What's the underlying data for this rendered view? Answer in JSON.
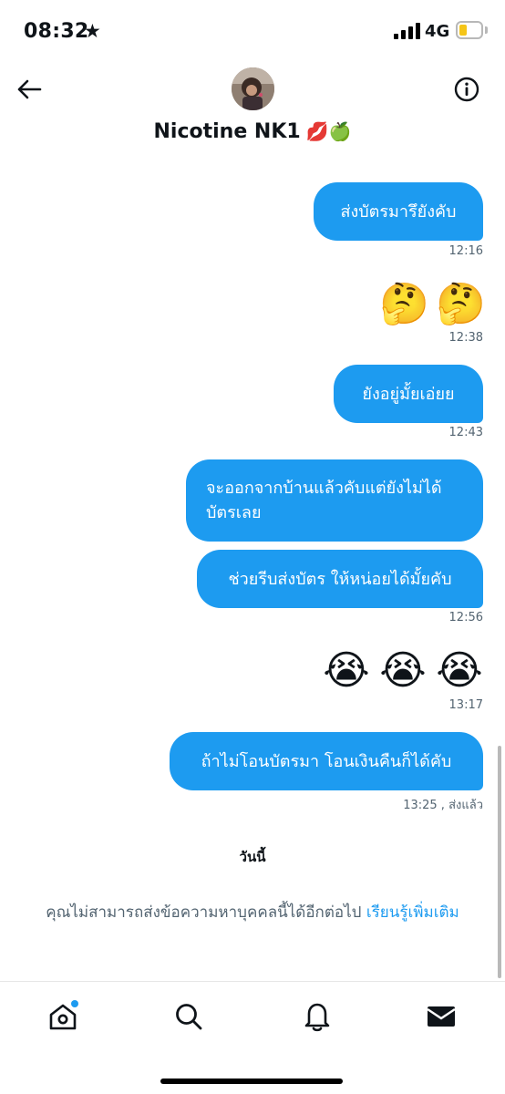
{
  "status_bar": {
    "time": "08:32",
    "network": "4G",
    "battery_level": 0.35,
    "accent_colors": {
      "battery": "#f5c518"
    }
  },
  "header": {
    "contact_name": "Nicotine NK1",
    "name_emojis": "💋🍏",
    "back_icon": "arrow-left-icon",
    "info_icon": "info-circle-icon"
  },
  "messages": [
    {
      "text": "ส่งบัตรมารึยังคับ",
      "time": "12:16"
    },
    {
      "text": "🤔🤔",
      "emojis": [
        "🤔",
        "🤔"
      ],
      "time": "12:38"
    },
    {
      "text": "ยังอยู่มั้ยเอ่ยย",
      "time": "12:43"
    },
    {
      "text": "จะออกจากบ้านแล้วคับแต่ยังไม่ได้บัตรเลย",
      "lines": [
        "จะออกจากบ้านแล้วคับแต่ยังไม่ได้",
        "บัตรเลย"
      ]
    },
    {
      "text": "ช่วยรีบส่งบัตร ให้หน่อยได้มั้ยคับ",
      "time": "12:56"
    },
    {
      "text": "😭😭😭",
      "emojis": [
        "😭",
        "😭",
        "😭"
      ],
      "time": "13:17"
    },
    {
      "text": "ถ้าไม่โอนบัตรมา โอนเงินคืนก็ได้คับ",
      "time": "13:25 , ส่งแล้ว"
    }
  ],
  "date_divider": "วันนี้",
  "notice": {
    "text": "คุณไม่สามารถส่งข้อความหาบุคคลนี้ได้อีกต่อไป",
    "link": "เรียนรู้เพิ่มเติม"
  },
  "tab_bar": {
    "tabs": [
      "home-icon",
      "search-icon",
      "bell-icon",
      "mail-icon"
    ],
    "home_has_badge": true
  },
  "colors": {
    "bubble": "#1d9bf0",
    "link": "#1d9bf0",
    "muted_text": "#536471"
  }
}
